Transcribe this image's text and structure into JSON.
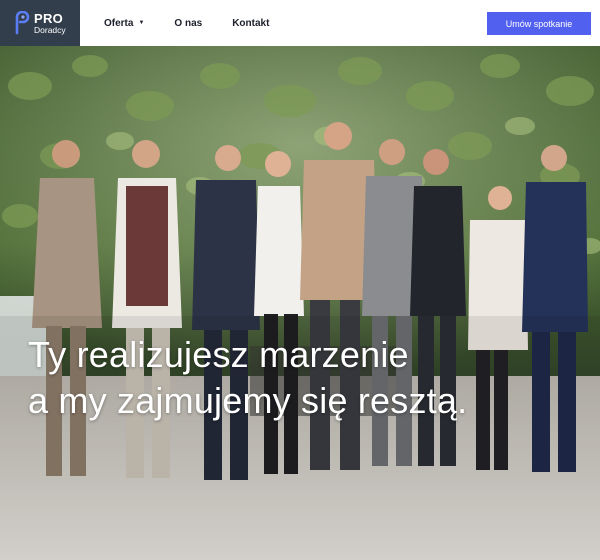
{
  "brand": {
    "name_top": "PRO",
    "name_bottom": "Doradcy",
    "logo_bg": "#333e4c",
    "accent": "#5260f0"
  },
  "nav": {
    "items": [
      {
        "label": "Oferta",
        "has_dropdown": true
      },
      {
        "label": "O nas",
        "has_dropdown": false
      },
      {
        "label": "Kontakt",
        "has_dropdown": false
      }
    ],
    "dropdown_icon": "caret-down-icon"
  },
  "cta": {
    "label": "Umów spotkanie"
  },
  "hero": {
    "headline_line1": "Ty realizujesz marzenie",
    "headline_line2": "a my zajmujemy się resztą.",
    "photo": "team-photo-plant-wall"
  }
}
